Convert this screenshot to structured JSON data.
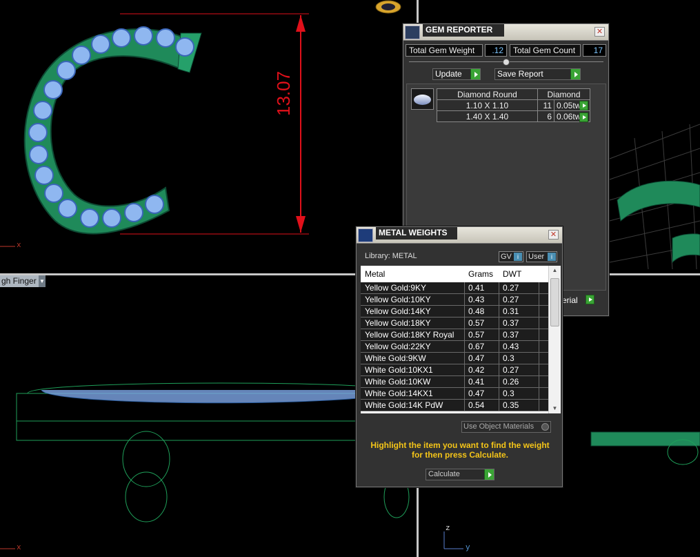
{
  "viewport": {
    "dimension_value": "13.07",
    "axis_x": "x",
    "axis_y": "y",
    "axis_z": "z",
    "view_select": "gh Finger"
  },
  "gem_reporter": {
    "title": "GEM REPORTER",
    "total_weight_label": "Total Gem Weight",
    "total_weight_value": ".12",
    "total_count_label": "Total Gem Count",
    "total_count_value": "17",
    "update_label": "Update",
    "save_report_label": "Save Report",
    "gem_table": {
      "shape": "Diamond Round",
      "material": "Diamond",
      "rows": [
        {
          "size": "1.10 X 1.10",
          "count": "11",
          "weight": "0.05tw"
        },
        {
          "size": "1.40 X 1.40",
          "count": "6",
          "weight": "0.06tw"
        }
      ]
    },
    "material_button_label": "erial"
  },
  "metal_weights": {
    "title": "METAL WEIGHTS",
    "library_label": "Library: METAL",
    "gv_label": "GV",
    "user_label": "User",
    "columns": [
      "Metal",
      "Grams",
      "DWT"
    ],
    "rows": [
      {
        "metal": "Yellow Gold:9KY",
        "grams": "0.41",
        "dwt": "0.27"
      },
      {
        "metal": "Yellow Gold:10KY",
        "grams": "0.43",
        "dwt": "0.27"
      },
      {
        "metal": "Yellow Gold:14KY",
        "grams": "0.48",
        "dwt": "0.31"
      },
      {
        "metal": "Yellow Gold:18KY",
        "grams": "0.57",
        "dwt": "0.37"
      },
      {
        "metal": "Yellow Gold:18KY Royal",
        "grams": "0.57",
        "dwt": "0.37"
      },
      {
        "metal": "Yellow Gold:22KY",
        "grams": "0.67",
        "dwt": "0.43"
      },
      {
        "metal": "White Gold:9KW",
        "grams": "0.47",
        "dwt": "0.3"
      },
      {
        "metal": "White Gold:10KX1",
        "grams": "0.42",
        "dwt": "0.27"
      },
      {
        "metal": "White Gold:10KW",
        "grams": "0.41",
        "dwt": "0.26"
      },
      {
        "metal": "White Gold:14KX1",
        "grams": "0.47",
        "dwt": "0.3"
      },
      {
        "metal": "White Gold:14K PdW",
        "grams": "0.54",
        "dwt": "0.35"
      }
    ],
    "use_object_materials_label": "Use Object Materials",
    "instructions": "Highlight the item you want to find the weight for then press Calculate.",
    "calculate_label": "Calculate"
  },
  "colors": {
    "accent_green": "#3aa435",
    "instruction_yellow": "#f5c518",
    "dimension_red": "#e0101a",
    "model_green": "#1f8a5a",
    "gem_blue": "#8fb7f0"
  }
}
